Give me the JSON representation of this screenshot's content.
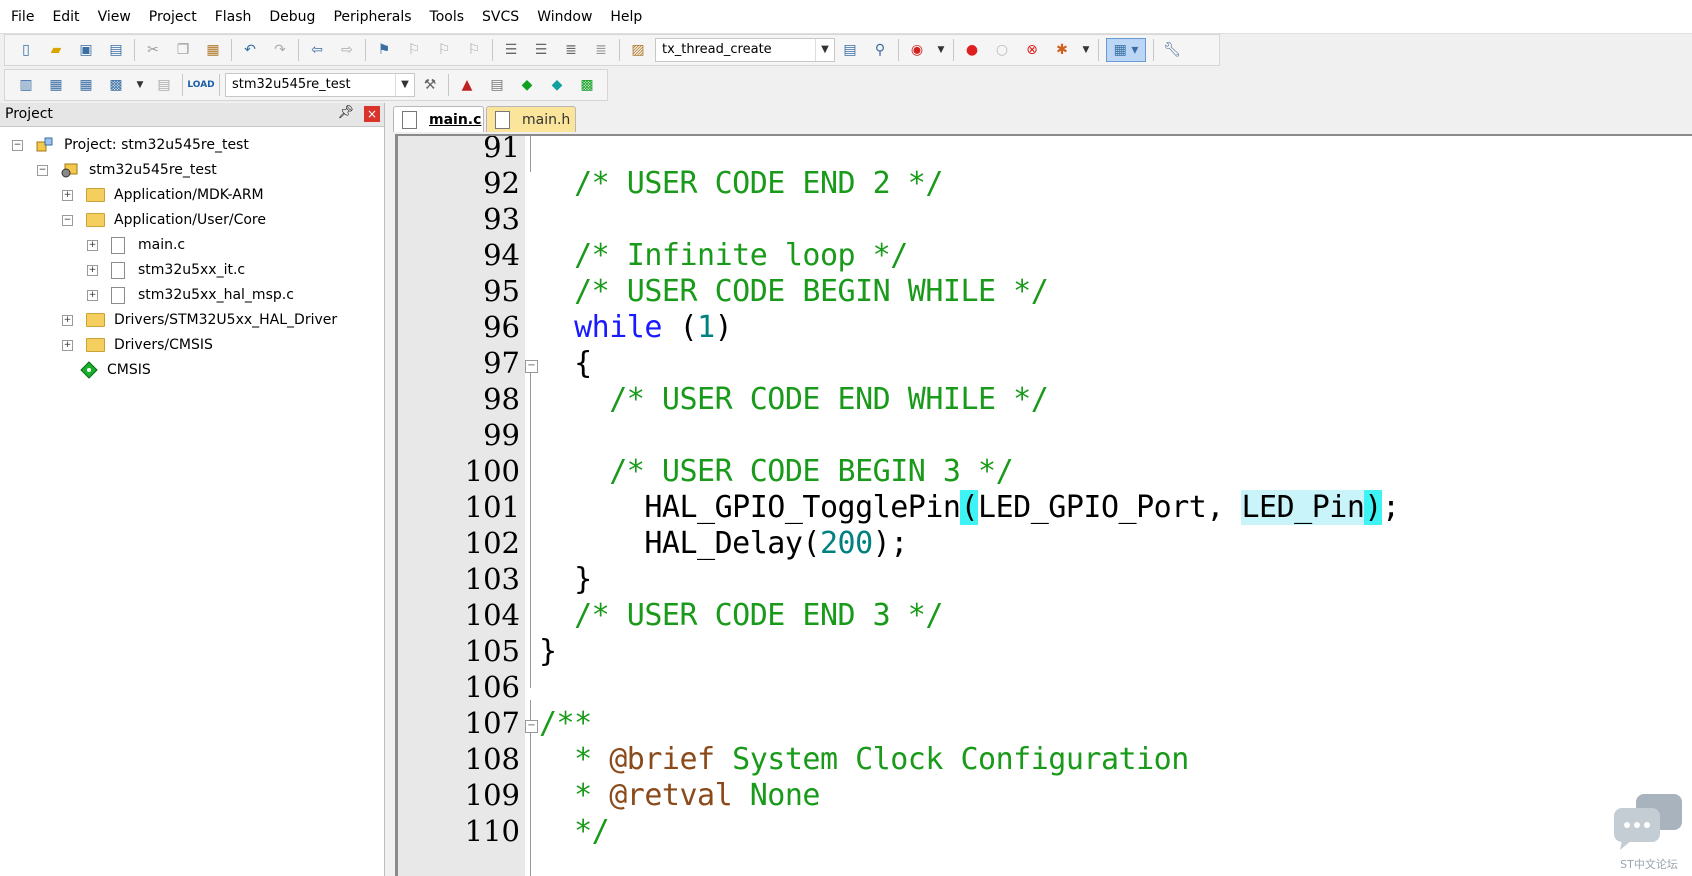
{
  "menu": [
    "File",
    "Edit",
    "View",
    "Project",
    "Flash",
    "Debug",
    "Peripherals",
    "Tools",
    "SVCS",
    "Window",
    "Help"
  ],
  "toolbar1": {
    "function_combo": "tx_thread_create"
  },
  "toolbar2": {
    "target_combo": "stm32u545re_test"
  },
  "project_panel": {
    "title": "Project",
    "tree": [
      {
        "label": "Project: stm32u545re_test"
      },
      {
        "label": "stm32u545re_test"
      },
      {
        "label": "Application/MDK-ARM"
      },
      {
        "label": "Application/User/Core"
      },
      {
        "label": "main.c"
      },
      {
        "label": "stm32u5xx_it.c"
      },
      {
        "label": "stm32u5xx_hal_msp.c"
      },
      {
        "label": "Drivers/STM32U5xx_HAL_Driver"
      },
      {
        "label": "Drivers/CMSIS"
      },
      {
        "label": "CMSIS"
      }
    ]
  },
  "tabs": [
    {
      "label": "main.c",
      "active": true
    },
    {
      "label": "main.h",
      "active": false
    }
  ],
  "editor": {
    "lines": [
      {
        "n": "91",
        "code": ""
      },
      {
        "n": "92",
        "code": "  /* USER CODE END 2 */"
      },
      {
        "n": "93",
        "code": ""
      },
      {
        "n": "94",
        "code": "  /* Infinite loop */"
      },
      {
        "n": "95",
        "code": "  /* USER CODE BEGIN WHILE */"
      },
      {
        "n": "96",
        "code": "  while (1)"
      },
      {
        "n": "97",
        "code": "  {"
      },
      {
        "n": "98",
        "code": "    /* USER CODE END WHILE */"
      },
      {
        "n": "99",
        "code": ""
      },
      {
        "n": "100",
        "code": "    /* USER CODE BEGIN 3 */"
      },
      {
        "n": "101",
        "code": "      HAL_GPIO_TogglePin(LED_GPIO_Port, LED_Pin);"
      },
      {
        "n": "102",
        "code": "      HAL_Delay(200);"
      },
      {
        "n": "103",
        "code": "  }"
      },
      {
        "n": "104",
        "code": "  /* USER CODE END 3 */"
      },
      {
        "n": "105",
        "code": "}"
      },
      {
        "n": "106",
        "code": ""
      },
      {
        "n": "107",
        "code": "/**"
      },
      {
        "n": "108",
        "code": "  * @brief System Clock Configuration"
      },
      {
        "n": "109",
        "code": "  * @retval None"
      },
      {
        "n": "110",
        "code": "  */"
      }
    ]
  },
  "watermark": "ST中文论坛"
}
